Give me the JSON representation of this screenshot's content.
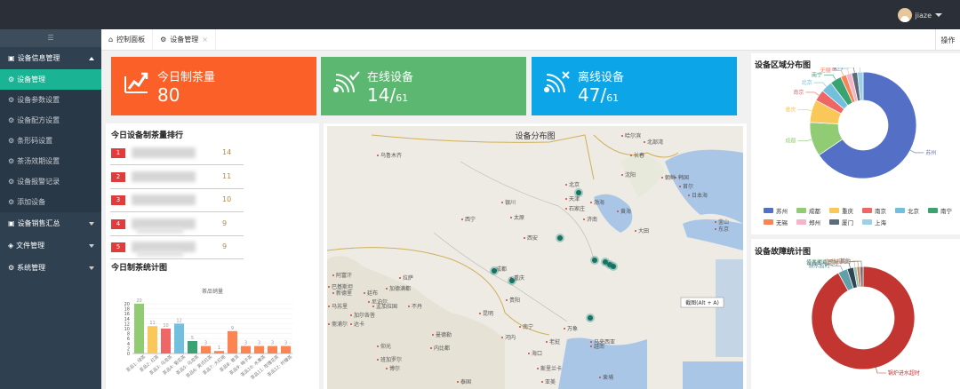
{
  "user": {
    "name": "jiaze"
  },
  "sidebar": {
    "toggle": "☰",
    "groups": [
      {
        "label": "设备信息管理",
        "items": [
          "设备管理",
          "设备参数设置",
          "设备配方设置",
          "条形码设置",
          "茶汤效期设置",
          "设备报警记录",
          "添加设备"
        ]
      },
      {
        "label": "设备销售汇总"
      },
      {
        "label": "文件管理"
      },
      {
        "label": "系统管理"
      }
    ]
  },
  "tabs": [
    {
      "label": "控制面板"
    },
    {
      "label": "设备管理"
    }
  ],
  "tabs_close": "×",
  "ops_label": "操作",
  "stats": [
    {
      "label": "今日制茶量",
      "value": "80",
      "total": ""
    },
    {
      "label": "在线设备",
      "value": "14/",
      "total": "61"
    },
    {
      "label": "离线设备",
      "value": "47/",
      "total": "61"
    }
  ],
  "ranking": {
    "title": "今日设备制茶量排行",
    "rows": [
      {
        "rank": "1",
        "count": "14"
      },
      {
        "rank": "2",
        "count": "11"
      },
      {
        "rank": "3",
        "count": "10"
      },
      {
        "rank": "4",
        "count": "9"
      },
      {
        "rank": "5",
        "count": "9"
      }
    ]
  },
  "tea_chart": {
    "title": "今日制茶统计图",
    "chart_data": {
      "type": "bar",
      "title": "茶品销量",
      "ylim": [
        0,
        20
      ],
      "yticks": [
        0,
        2,
        4,
        6,
        8,
        10,
        12,
        14,
        16,
        18,
        20
      ],
      "categories": [
        "茶品1: 绿茶",
        "茶品2: 红茶",
        "茶品3: 乌龙茶",
        "茶品4: 菊花茶",
        "茶品5: 乌龙茶",
        "茶品6: 英式红茶",
        "茶品7: 大红袍",
        "茶品8: 普洱",
        "茶品9: 梅子茶",
        "茶品10: 水果茶",
        "茶品11: 玫瑰花茶",
        "茶品12: 柠檬茶"
      ],
      "values": [
        20,
        11,
        10,
        12,
        5,
        3,
        1,
        9,
        3,
        3,
        3,
        3
      ],
      "colors": [
        "#91cc75",
        "#fac858",
        "#ee6666",
        "#73c0de",
        "#3ba272",
        "#fc8452",
        "#fc8452",
        "#fc8452",
        "#fc8452",
        "#fc8452",
        "#fc8452",
        "#fc8452"
      ]
    }
  },
  "map": {
    "title": "设备分布图",
    "tooltip": "截图(Alt + A)",
    "labels": [
      "哈尔滨",
      "乌鲁木齐",
      "长春",
      "沈阳",
      "北京",
      "天津",
      "石家庄",
      "济南",
      "日本海",
      "渤海",
      "黄海",
      "西宁",
      "银川",
      "太原",
      "西安",
      "首尔",
      "大田",
      "釜山",
      "东京",
      "成都",
      "重庆",
      "贵阳",
      "拉萨",
      "加德满都",
      "廷布",
      "达卡",
      "昆明",
      "南宁",
      "河内",
      "海口",
      "仰光",
      "曼德勒",
      "内比都",
      "万象",
      "泰国",
      "老挝",
      "越南",
      "不丹",
      "孟加拉国",
      "阿富汗",
      "新德里",
      "尼泊尔",
      "巴基斯坦",
      "马苏里",
      "加尔各答",
      "斋浦尔",
      "班加罗尔",
      "博尔",
      "斯里兰卡",
      "亚美",
      "柬埔",
      "马来西亚",
      "北部湾",
      "朝鲜",
      "韩国"
    ],
    "devices_count": 9
  },
  "region": {
    "title": "设备区域分布图",
    "chart_data": {
      "type": "pie",
      "title": "",
      "legend": "bottom",
      "categories": [
        "苏州",
        "成都",
        "重庆",
        "南京",
        "北京",
        "南宁",
        "无锡",
        "郑州",
        "厦门",
        "上海"
      ],
      "values": [
        38,
        6,
        4,
        2,
        2,
        2,
        1,
        1,
        1,
        1
      ],
      "colors": [
        "#5470c6",
        "#91cc75",
        "#fac858",
        "#ee6666",
        "#73c0de",
        "#3ba272",
        "#fc8452",
        "#f5b5c8",
        "#5c6b7a",
        "#9bd0e8"
      ]
    }
  },
  "fault": {
    "title": "设备故障统计图",
    "chart_data": {
      "type": "pie",
      "categories": [
        "锅炉进水超时",
        "缺水超时",
        "设备断电超时",
        "温度传感器故障",
        "加热超时",
        "其他"
      ],
      "values": [
        92,
        3,
        2,
        1,
        1,
        1
      ],
      "colors": [
        "#c23531",
        "#61a0a8",
        "#2f4554",
        "#91c7ae",
        "#d48265",
        "#6e7074"
      ]
    }
  }
}
